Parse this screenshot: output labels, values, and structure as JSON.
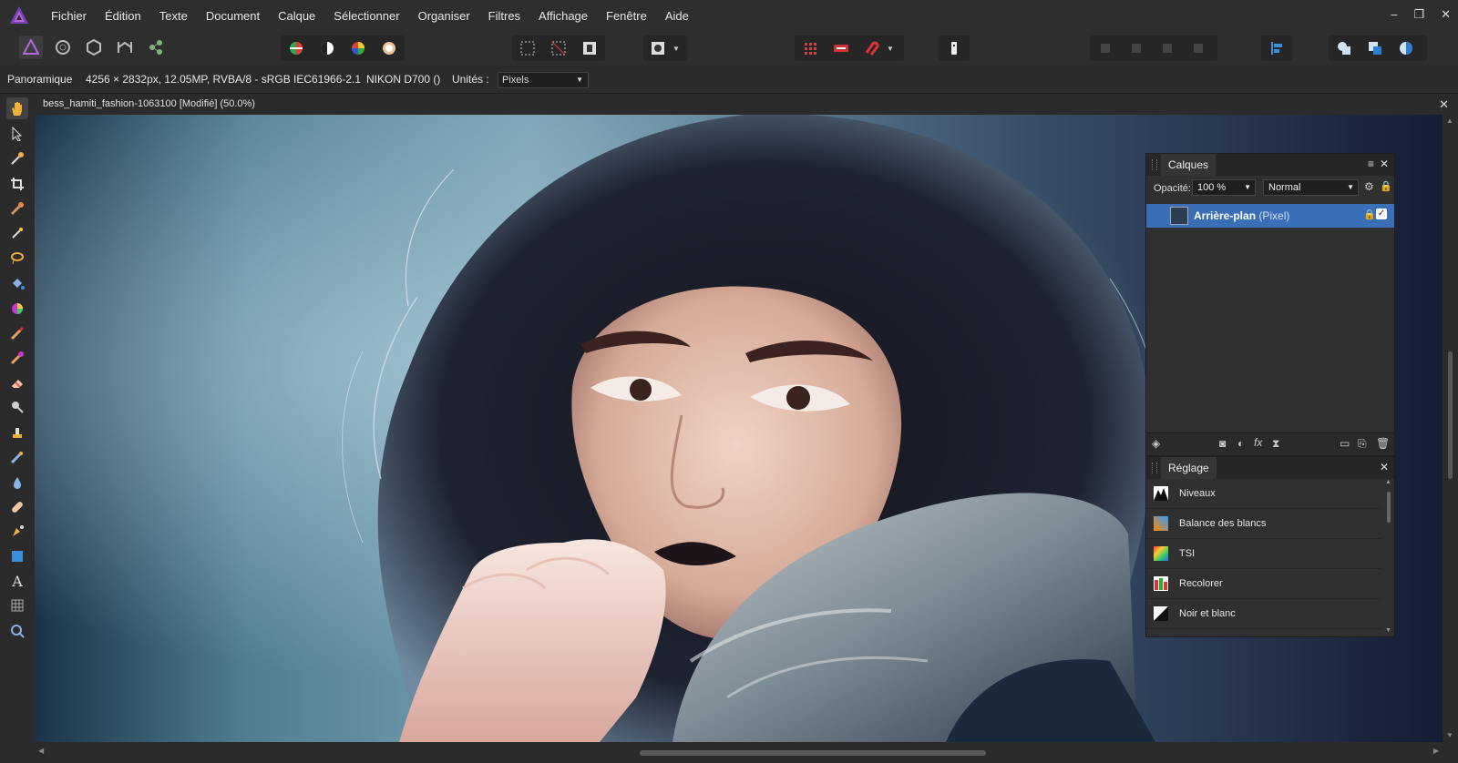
{
  "app": {
    "logo": "affinity-photo-logo"
  },
  "menu": {
    "items": [
      "Fichier",
      "Édition",
      "Texte",
      "Document",
      "Calque",
      "Sélectionner",
      "Organiser",
      "Filtres",
      "Affichage",
      "Fenêtre",
      "Aide"
    ],
    "window_controls": [
      "–",
      "❐",
      "✕"
    ]
  },
  "context": {
    "tool_name": "Panoramique",
    "image_info": "4256 × 2832px, 12.05MP, RVBA/8 - sRGB IEC61966-2.1",
    "camera": "NIKON D700 ()",
    "units_label": "Unités :",
    "units_value": "Pixels"
  },
  "document": {
    "title": "bess_hamiti_fashion-1063100 [Modifié] (50.0%)",
    "close": "✕"
  },
  "layers_panel": {
    "tab": "Calques",
    "opacity_label": "Opacité:",
    "opacity_value": "100 %",
    "blend_mode": "Normal",
    "layer": {
      "name": "Arrière-plan",
      "type": "(Pixel)"
    }
  },
  "adjust_panel": {
    "tab": "Réglage",
    "items": [
      "Niveaux",
      "Balance des blancs",
      "TSI",
      "Recolorer",
      "Noir et blanc"
    ]
  },
  "colors": {
    "accent": "#3a6fb7",
    "panel": "#303030",
    "bg": "#2b2b2b"
  }
}
